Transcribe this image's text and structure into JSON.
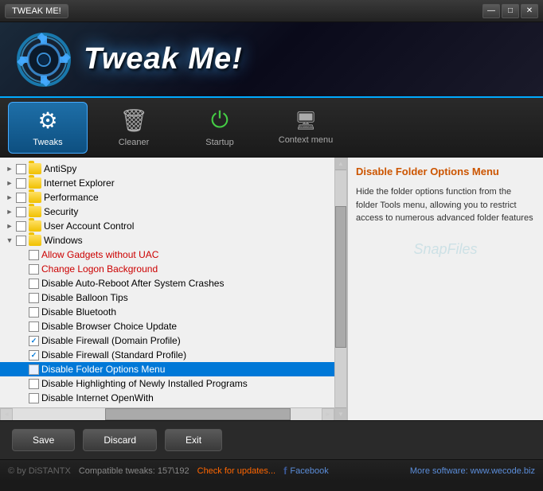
{
  "titlebar": {
    "menu_label": "TWEAK ME!",
    "minimize": "—",
    "maximize": "□",
    "close": "✕"
  },
  "header": {
    "title": "Tweak Me!"
  },
  "tabs": [
    {
      "id": "tweaks",
      "label": "Tweaks",
      "active": true,
      "icon": "⚙"
    },
    {
      "id": "cleaner",
      "label": "Cleaner",
      "active": false,
      "icon": "🗑"
    },
    {
      "id": "startup",
      "label": "Startup",
      "active": false,
      "icon": "⏻"
    },
    {
      "id": "context_menu",
      "label": "Context menu",
      "active": false,
      "icon": "🖥"
    }
  ],
  "info_panel": {
    "title": "Disable Folder Options Menu",
    "description": "Hide the folder options function from the folder Tools menu, allowing you to restrict access to numerous advanced folder features",
    "watermark": "SnapFiles"
  },
  "tree": {
    "items": [
      {
        "id": "antispy",
        "label": "AntiSpy",
        "type": "group",
        "indent": 0,
        "expanded": false,
        "checked": false
      },
      {
        "id": "ie",
        "label": "Internet Explorer",
        "type": "group",
        "indent": 0,
        "expanded": false,
        "checked": false
      },
      {
        "id": "performance",
        "label": "Performance",
        "type": "group",
        "indent": 0,
        "expanded": false,
        "checked": false
      },
      {
        "id": "security",
        "label": "Security",
        "type": "group",
        "indent": 0,
        "expanded": false,
        "checked": false
      },
      {
        "id": "uac",
        "label": "User Account Control",
        "type": "group",
        "indent": 0,
        "expanded": false,
        "checked": false
      },
      {
        "id": "windows",
        "label": "Windows",
        "type": "group",
        "indent": 0,
        "expanded": true,
        "checked": false
      },
      {
        "id": "allow_gadgets",
        "label": "Allow Gadgets without UAC",
        "type": "item",
        "indent": 1,
        "checked": false,
        "color": "red"
      },
      {
        "id": "change_logon",
        "label": "Change Logon Background",
        "type": "item",
        "indent": 1,
        "checked": false,
        "color": "red"
      },
      {
        "id": "disable_autoreboot",
        "label": "Disable Auto-Reboot After System Crashes",
        "type": "item",
        "indent": 1,
        "checked": false,
        "color": "normal"
      },
      {
        "id": "disable_balloon",
        "label": "Disable Balloon Tips",
        "type": "item",
        "indent": 1,
        "checked": false,
        "color": "normal"
      },
      {
        "id": "disable_bluetooth",
        "label": "Disable Bluetooth",
        "type": "item",
        "indent": 1,
        "checked": false,
        "color": "normal"
      },
      {
        "id": "disable_browser_choice",
        "label": "Disable Browser Choice Update",
        "type": "item",
        "indent": 1,
        "checked": false,
        "color": "normal"
      },
      {
        "id": "disable_fw_domain",
        "label": "Disable Firewall (Domain Profile)",
        "type": "item",
        "indent": 1,
        "checked": true,
        "color": "normal"
      },
      {
        "id": "disable_fw_standard",
        "label": "Disable Firewall (Standard Profile)",
        "type": "item",
        "indent": 1,
        "checked": true,
        "color": "normal"
      },
      {
        "id": "disable_folder_options",
        "label": "Disable Folder Options Menu",
        "type": "item",
        "indent": 1,
        "checked": false,
        "color": "normal",
        "selected": true
      },
      {
        "id": "disable_highlighting",
        "label": "Disable Highlighting of Newly Installed Programs",
        "type": "item",
        "indent": 1,
        "checked": false,
        "color": "normal"
      },
      {
        "id": "disable_internet_openwith",
        "label": "Disable Internet OpenWith",
        "type": "item",
        "indent": 1,
        "checked": false,
        "color": "normal"
      }
    ]
  },
  "actions": {
    "save": "Save",
    "discard": "Discard",
    "exit": "Exit"
  },
  "statusbar": {
    "copyright": "© by DiSTANTX",
    "tweaks": "Compatible tweaks: 157\\192",
    "update": "Check for updates...",
    "facebook": "Facebook",
    "website": "More software: www.wecode.biz"
  }
}
